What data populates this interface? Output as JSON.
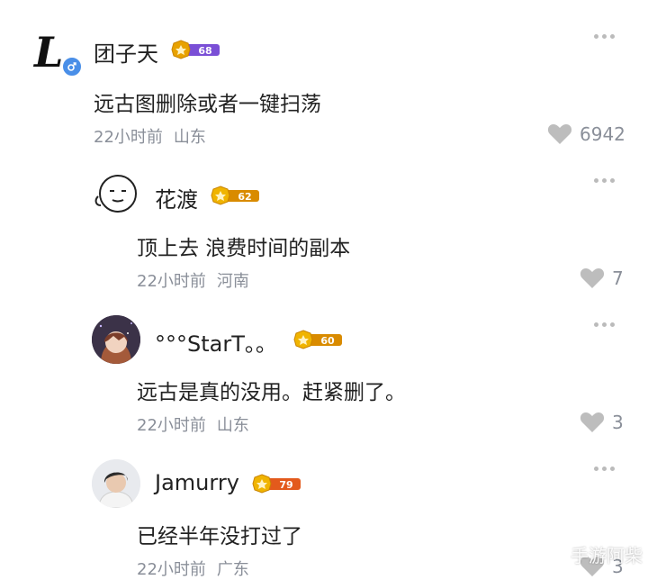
{
  "colors": {
    "text": "#222222",
    "meta": "#8a8f99",
    "heart": "#bdbdbd",
    "badge_bg": "#7a4fd6",
    "badge_gold": "#e8a200"
  },
  "comments": [
    {
      "username": "团子天",
      "level": "68",
      "gender_icon": "male-icon",
      "text": "远古图删除或者一键扫荡",
      "time": "22小时前",
      "location": "山东",
      "likes": "6942"
    },
    {
      "username": "花渡",
      "level": "62",
      "text": "顶上去 浪费时间的副本",
      "time": "22小时前",
      "location": "河南",
      "likes": "7"
    },
    {
      "username": "°°°StarT。。",
      "level": "60",
      "text": "远古是真的没用。赶紧删了。",
      "time": "22小时前",
      "location": "山东",
      "likes": "3"
    },
    {
      "username": "Jamurry",
      "level": "79",
      "text": "已经半年没打过了",
      "time": "22小时前",
      "location": "广东",
      "likes": "3"
    }
  ],
  "watermark": "手游阿柴"
}
